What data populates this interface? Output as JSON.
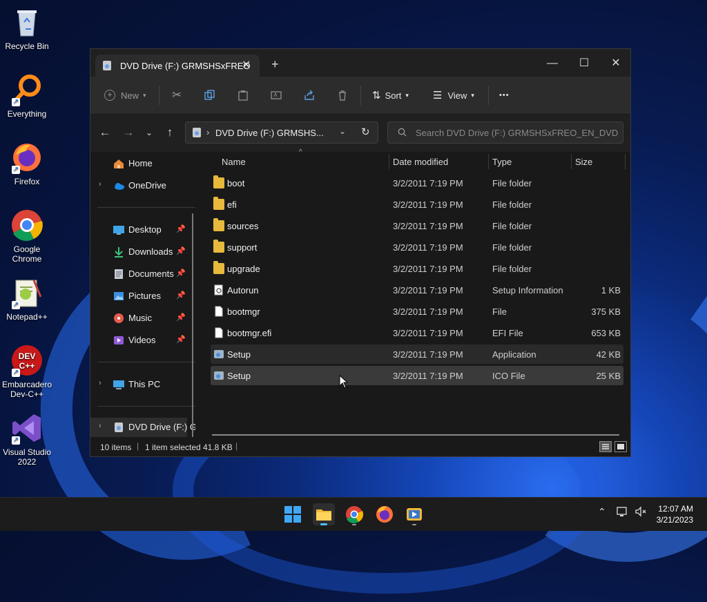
{
  "desktop": {
    "icons": [
      {
        "label": "Recycle Bin",
        "icon": "recycle-bin-icon"
      },
      {
        "label": "Everything",
        "icon": "everything-icon"
      },
      {
        "label": "Firefox",
        "icon": "firefox-icon"
      },
      {
        "label": "Google Chrome",
        "icon": "chrome-icon"
      },
      {
        "label": "Notepad++",
        "icon": "notepadpp-icon"
      },
      {
        "label": "Embarcadero Dev-C++",
        "icon": "devcpp-icon"
      },
      {
        "label": "Visual Studio 2022",
        "icon": "visual-studio-icon"
      }
    ]
  },
  "window": {
    "tab_title": "DVD Drive (F:) GRMSHSxFREO",
    "new_tab": "+",
    "controls": {
      "minimize": "—",
      "maximize": "☐",
      "close": "✕"
    }
  },
  "toolbar": {
    "new_label": "New",
    "sort_label": "Sort",
    "view_label": "View",
    "more": "•••"
  },
  "address": {
    "path": "DVD Drive (F:) GRMSHS...",
    "search_placeholder": "Search DVD Drive (F:) GRMSHSxFREO_EN_DVD"
  },
  "nav": {
    "home": "Home",
    "onedrive": "OneDrive",
    "quick": [
      {
        "label": "Desktop"
      },
      {
        "label": "Downloads"
      },
      {
        "label": "Documents"
      },
      {
        "label": "Pictures"
      },
      {
        "label": "Music"
      },
      {
        "label": "Videos"
      }
    ],
    "thispc": "This PC",
    "dvd": "DVD Drive (F:) G"
  },
  "columns": {
    "name": "Name",
    "date": "Date modified",
    "type": "Type",
    "size": "Size"
  },
  "files": [
    {
      "name": "boot",
      "date": "3/2/2011 7:19 PM",
      "type": "File folder",
      "size": "",
      "kind": "folder"
    },
    {
      "name": "efi",
      "date": "3/2/2011 7:19 PM",
      "type": "File folder",
      "size": "",
      "kind": "folder"
    },
    {
      "name": "sources",
      "date": "3/2/2011 7:19 PM",
      "type": "File folder",
      "size": "",
      "kind": "folder"
    },
    {
      "name": "support",
      "date": "3/2/2011 7:19 PM",
      "type": "File folder",
      "size": "",
      "kind": "folder"
    },
    {
      "name": "upgrade",
      "date": "3/2/2011 7:19 PM",
      "type": "File folder",
      "size": "",
      "kind": "folder"
    },
    {
      "name": "Autorun",
      "date": "3/2/2011 7:19 PM",
      "type": "Setup Information",
      "size": "1 KB",
      "kind": "inf"
    },
    {
      "name": "bootmgr",
      "date": "3/2/2011 7:19 PM",
      "type": "File",
      "size": "375 KB",
      "kind": "file"
    },
    {
      "name": "bootmgr.efi",
      "date": "3/2/2011 7:19 PM",
      "type": "EFI File",
      "size": "653 KB",
      "kind": "file"
    },
    {
      "name": "Setup",
      "date": "3/2/2011 7:19 PM",
      "type": "Application",
      "size": "42 KB",
      "kind": "app"
    },
    {
      "name": "Setup",
      "date": "3/2/2011 7:19 PM",
      "type": "ICO File",
      "size": "25 KB",
      "kind": "app"
    }
  ],
  "status": {
    "count": "10 items",
    "selected": "1 item selected",
    "size": "41.8 KB"
  },
  "taskbar": {
    "time": "12:07 AM",
    "date": "3/21/2023"
  },
  "colors": {
    "accent": "#4cc2ff",
    "folder": "#e7b93c",
    "window_bg": "#191919"
  }
}
